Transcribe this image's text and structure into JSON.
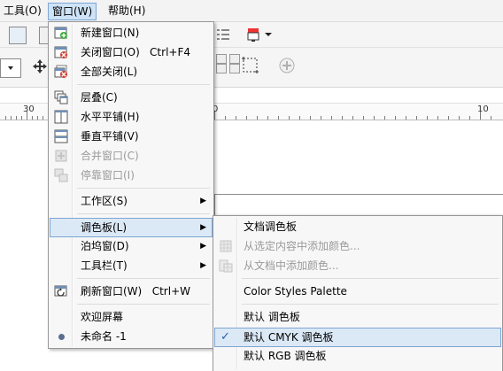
{
  "menubar": {
    "items": [
      {
        "label": "工具(O)"
      },
      {
        "label": "窗口(W)"
      },
      {
        "label": "帮助(H)"
      }
    ]
  },
  "ruler": {
    "numbers": [
      "30",
      "0",
      "10"
    ]
  },
  "window_menu": {
    "items": [
      {
        "label": "新建窗口(N)",
        "shortcut": ""
      },
      {
        "label": "关闭窗口(O)",
        "shortcut": "Ctrl+F4"
      },
      {
        "label": "全部关闭(L)",
        "shortcut": ""
      },
      {
        "label": "层叠(C)",
        "shortcut": ""
      },
      {
        "label": "水平平铺(H)",
        "shortcut": ""
      },
      {
        "label": "垂直平铺(V)",
        "shortcut": ""
      },
      {
        "label": "合并窗口(C)",
        "shortcut": ""
      },
      {
        "label": "停靠窗口(I)",
        "shortcut": ""
      },
      {
        "label": "工作区(S)",
        "shortcut": ""
      },
      {
        "label": "调色板(L)",
        "shortcut": ""
      },
      {
        "label": "泊坞窗(D)",
        "shortcut": ""
      },
      {
        "label": "工具栏(T)",
        "shortcut": ""
      },
      {
        "label": "刷新窗口(W)",
        "shortcut": "Ctrl+W"
      },
      {
        "label": "欢迎屏幕",
        "shortcut": ""
      },
      {
        "label": "未命名 -1",
        "shortcut": ""
      }
    ]
  },
  "palette_submenu": {
    "items": [
      {
        "label": "文档调色板"
      },
      {
        "label": "从选定内容中添加颜色..."
      },
      {
        "label": "从文档中添加颜色..."
      },
      {
        "label": "Color Styles Palette"
      },
      {
        "label": "默认 调色板"
      },
      {
        "label": "默认 CMYK 调色板"
      },
      {
        "label": "默认 RGB 调色板"
      }
    ]
  },
  "colors": {
    "highlight": "#dbe8f6",
    "highlight_border": "#7ea6d4",
    "menu_bg": "#f7f7f7",
    "disabled": "#9a9a9a"
  }
}
